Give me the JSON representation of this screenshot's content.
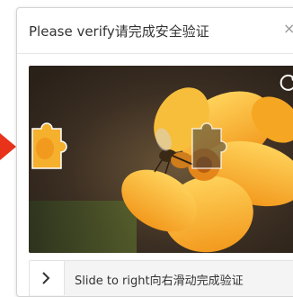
{
  "dialog": {
    "title": "Please verify请完成安全验证",
    "close_glyph": "×"
  },
  "puzzle": {
    "background_description_icon": "flower-bee-image",
    "refresh_icon": "refresh-icon"
  },
  "slider": {
    "handle_icon": "chevron-right-icon",
    "hint": "Slide to right向右滑动完成验证"
  },
  "colors": {
    "pointer": "#e8321a",
    "petal": "#f6b12c",
    "background_dark": "#3e2f22"
  }
}
